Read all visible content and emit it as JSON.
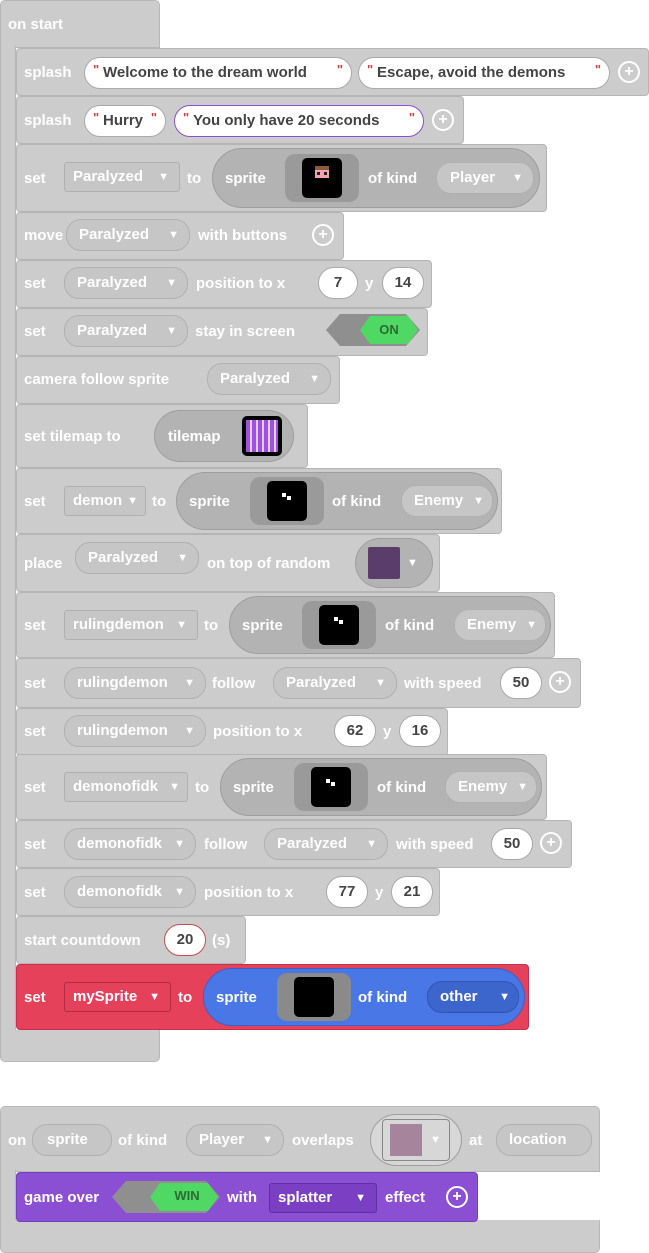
{
  "on_start": {
    "hat": "on start",
    "splash1": {
      "kw": "splash",
      "text1": "Welcome to the dream world",
      "text2": "Escape, avoid the demons"
    },
    "splash2": {
      "kw": "splash",
      "text1": "Hurry",
      "text2": "You only have 20 seconds"
    },
    "set_player": {
      "kw_set": "set",
      "var": "Paralyzed",
      "kw_to": "to",
      "kw_sprite": "sprite",
      "kw_of_kind": "of kind",
      "kind": "Player"
    },
    "move": {
      "kw": "move",
      "var": "Paralyzed",
      "kw_with": "with buttons"
    },
    "position1": {
      "kw": "set",
      "var": "Paralyzed",
      "kw_pos": "position to x",
      "x": "7",
      "kw_y": "y",
      "y": "14"
    },
    "stay": {
      "kw": "set",
      "var": "Paralyzed",
      "kw_stay": "stay in screen",
      "toggle": "ON"
    },
    "camera": {
      "kw": "camera follow sprite",
      "var": "Paralyzed"
    },
    "tilemap": {
      "kw": "set tilemap to",
      "kw_tilemap": "tilemap"
    },
    "set_demon": {
      "kw_set": "set",
      "var": "demon",
      "kw_to": "to",
      "kw_sprite": "sprite",
      "kw_of_kind": "of kind",
      "kind": "Enemy"
    },
    "place": {
      "kw": "place",
      "var": "Paralyzed",
      "kw_on": "on top of random",
      "tile_color": "#5b3d6b"
    },
    "set_ruling": {
      "kw_set": "set",
      "var": "rulingdemon",
      "kw_to": "to",
      "kw_sprite": "sprite",
      "kw_of_kind": "of kind",
      "kind": "Enemy"
    },
    "follow1": {
      "kw_set": "set",
      "var": "rulingdemon",
      "kw_follow": "follow",
      "target": "Paralyzed",
      "kw_speed": "with speed",
      "speed": "50"
    },
    "position2": {
      "kw": "set",
      "var": "rulingdemon",
      "kw_pos": "position to x",
      "x": "62",
      "kw_y": "y",
      "y": "16"
    },
    "set_idk": {
      "kw_set": "set",
      "var": "demonofidk",
      "kw_to": "to",
      "kw_sprite": "sprite",
      "kw_of_kind": "of kind",
      "kind": "Enemy"
    },
    "follow2": {
      "kw_set": "set",
      "var": "demonofidk",
      "kw_follow": "follow",
      "target": "Paralyzed",
      "kw_speed": "with speed",
      "speed": "50"
    },
    "position3": {
      "kw": "set",
      "var": "demonofidk",
      "kw_pos": "position to x",
      "x": "77",
      "kw_y": "y",
      "y": "21"
    },
    "countdown": {
      "kw": "start countdown",
      "value": "20",
      "unit": "(s)"
    },
    "set_my": {
      "kw_set": "set",
      "var": "mySprite",
      "kw_to": "to",
      "kw_sprite": "sprite",
      "kw_of_kind": "of kind",
      "kind": "other"
    }
  },
  "on_overlap": {
    "kw_on": "on",
    "var": "sprite",
    "kw_of_kind": "of kind",
    "kind": "Player",
    "kw_overlaps": "overlaps",
    "kw_at": "at",
    "location": "location",
    "tile_color": "#a6849c",
    "game_over": {
      "kw": "game over",
      "toggle": "WIN",
      "kw_with": "with",
      "effect": "splatter",
      "kw_effect": "effect"
    }
  },
  "colors": {
    "block_gray": "#cccccc",
    "red_block": "#e5415b",
    "blue_sprite": "#4a77e6",
    "purple_game": "#8b4fd4",
    "toggle_green": "#4fd964",
    "string_quote": "#d14040"
  }
}
